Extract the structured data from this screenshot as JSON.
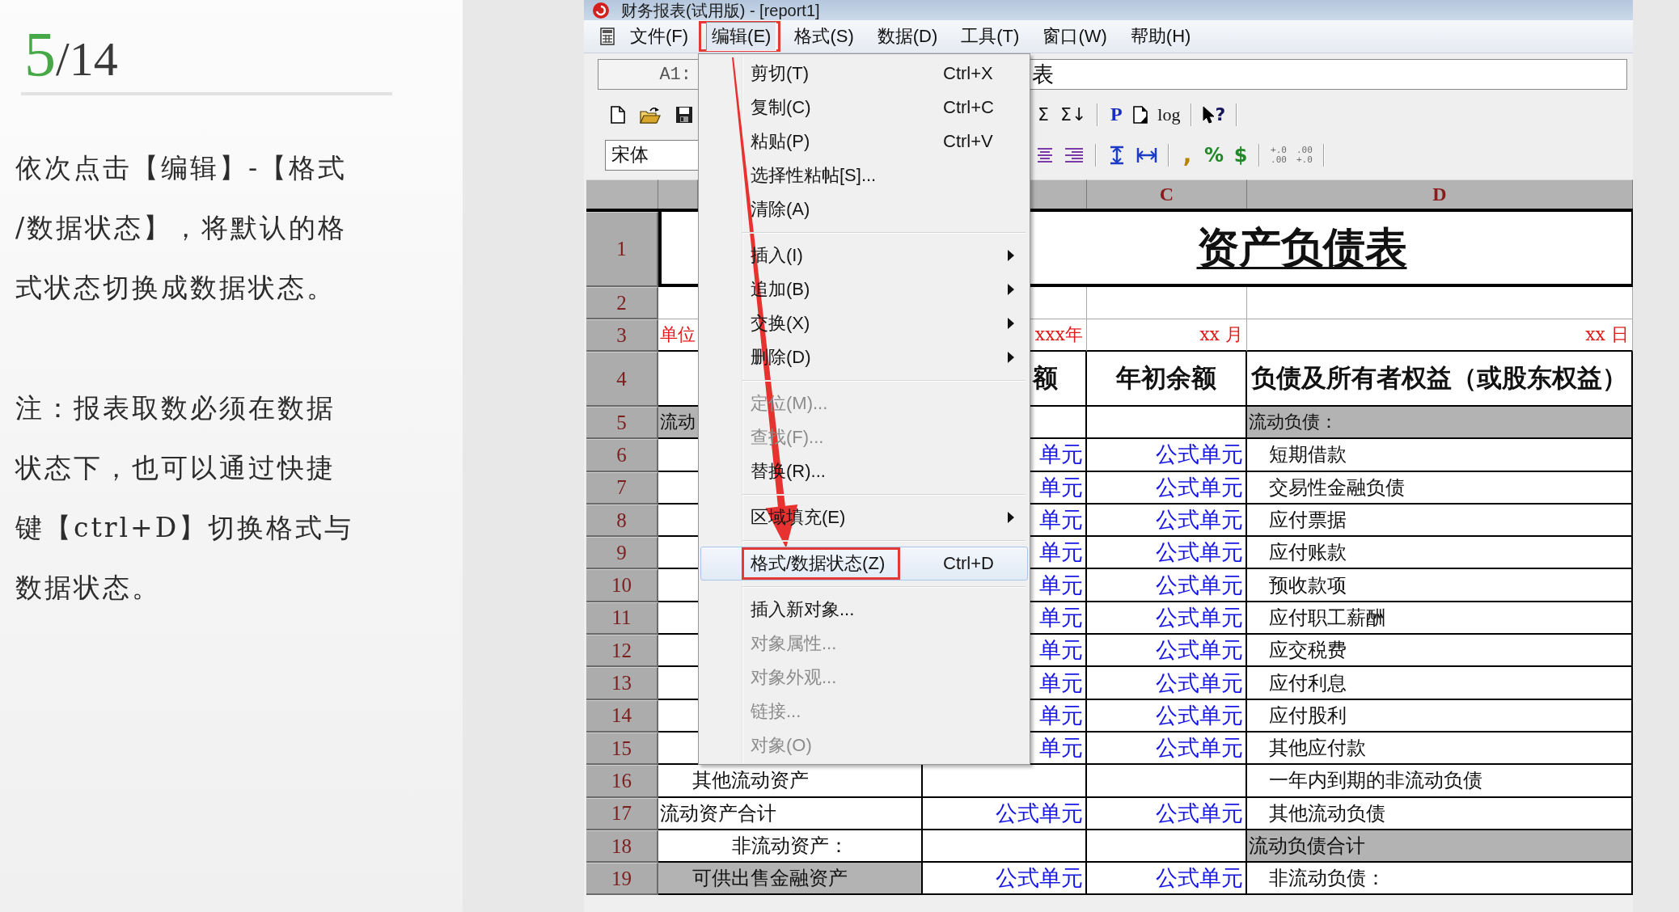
{
  "page_counter": {
    "current": "5",
    "total": "/14"
  },
  "instructions": [
    "依次点击【编辑】-【格式/数据状态】，将默认的格式状态切换成数据状态。",
    "注：报表取数必须在数据状态下，也可以通过快捷键【ctrl+D】切换格式与数据状态。"
  ],
  "window": {
    "title": "财务报表(试用版) - [report1]"
  },
  "menu_bar": [
    {
      "label": "文件(F)",
      "selected": false,
      "outlined": false
    },
    {
      "label": "编辑(E)",
      "selected": true,
      "outlined": true
    },
    {
      "label": "格式(S)",
      "selected": false,
      "outlined": false
    },
    {
      "label": "数据(D)",
      "selected": false,
      "outlined": false
    },
    {
      "label": "工具(T)",
      "selected": false,
      "outlined": false
    },
    {
      "label": "窗口(W)",
      "selected": false,
      "outlined": false
    },
    {
      "label": "帮助(H)",
      "selected": false,
      "outlined": false
    }
  ],
  "formula_bar": {
    "cell_ref": "A1:",
    "value": "表"
  },
  "toolbar_1": {
    "left": [
      {
        "kind": "new"
      },
      {
        "kind": "open"
      },
      {
        "kind": "save"
      }
    ],
    "right": [
      {
        "kind": "text",
        "glyph": "Σ"
      },
      {
        "kind": "text",
        "glyph": "Σ↓"
      },
      {
        "kind": "separator"
      },
      {
        "kind": "text-blue",
        "glyph": "P"
      },
      {
        "kind": "page"
      },
      {
        "kind": "text",
        "glyph": "log"
      },
      {
        "kind": "separator"
      },
      {
        "kind": "help",
        "glyph": "?"
      },
      {
        "kind": "separator"
      }
    ]
  },
  "toolbar_2": {
    "left": [
      {
        "kind": "font",
        "value": "宋体"
      }
    ],
    "right": [
      {
        "kind": "align-center"
      },
      {
        "kind": "align-right"
      },
      {
        "kind": "separator"
      },
      {
        "kind": "fit-height"
      },
      {
        "kind": "fit-width"
      },
      {
        "kind": "separator"
      },
      {
        "kind": "text-gold",
        "glyph": ","
      },
      {
        "kind": "text-green",
        "glyph": "%"
      },
      {
        "kind": "text-green",
        "glyph": "$"
      },
      {
        "kind": "separator"
      },
      {
        "kind": "decimals",
        "top": "+.0",
        "bottom": ".00"
      },
      {
        "kind": "decimals",
        "top": ".00",
        "bottom": "+.0"
      },
      {
        "kind": "separator"
      }
    ]
  },
  "edit_menu": {
    "arrow": true,
    "items": [
      {
        "kind": "item",
        "label": "剪切(T)",
        "shortcut": "Ctrl+X",
        "submenu": false,
        "disabled": false,
        "selected": false,
        "outlined": false
      },
      {
        "kind": "item",
        "label": "复制(C)",
        "shortcut": "Ctrl+C",
        "submenu": false,
        "disabled": false,
        "selected": false,
        "outlined": false
      },
      {
        "kind": "item",
        "label": "粘贴(P)",
        "shortcut": "Ctrl+V",
        "submenu": false,
        "disabled": false,
        "selected": false,
        "outlined": false
      },
      {
        "kind": "item",
        "label": "选择性粘帖[S]...",
        "submenu": false,
        "disabled": false,
        "selected": false,
        "outlined": false
      },
      {
        "kind": "item",
        "label": "清除(A)",
        "submenu": false,
        "disabled": false,
        "selected": false,
        "outlined": false
      },
      {
        "kind": "separator"
      },
      {
        "kind": "item",
        "label": "插入(I)",
        "submenu": true,
        "disabled": false,
        "selected": false,
        "outlined": false
      },
      {
        "kind": "item",
        "label": "追加(B)",
        "submenu": true,
        "disabled": false,
        "selected": false,
        "outlined": false
      },
      {
        "kind": "item",
        "label": "交换(X)",
        "submenu": true,
        "disabled": false,
        "selected": false,
        "outlined": false
      },
      {
        "kind": "item",
        "label": "删除(D)",
        "submenu": true,
        "disabled": false,
        "selected": false,
        "outlined": false
      },
      {
        "kind": "separator"
      },
      {
        "kind": "item",
        "label": "定位(M)...",
        "submenu": false,
        "disabled": true,
        "selected": false,
        "outlined": false
      },
      {
        "kind": "item",
        "label": "查找(F)...",
        "submenu": false,
        "disabled": true,
        "selected": false,
        "outlined": false
      },
      {
        "kind": "item",
        "label": "替换(R)...",
        "submenu": false,
        "disabled": false,
        "selected": false,
        "outlined": false
      },
      {
        "kind": "separator"
      },
      {
        "kind": "item",
        "label": "区域填充(E)",
        "submenu": true,
        "disabled": false,
        "selected": false,
        "outlined": false
      },
      {
        "kind": "separator"
      },
      {
        "kind": "item",
        "label": "格式/数据状态(Z)",
        "shortcut": "Ctrl+D",
        "submenu": false,
        "disabled": false,
        "selected": true,
        "outlined": true
      },
      {
        "kind": "separator"
      },
      {
        "kind": "item",
        "label": "插入新对象...",
        "submenu": false,
        "disabled": false,
        "selected": false,
        "outlined": false
      },
      {
        "kind": "item",
        "label": "对象属性...",
        "submenu": false,
        "disabled": true,
        "selected": false,
        "outlined": false
      },
      {
        "kind": "item",
        "label": "对象外观...",
        "submenu": false,
        "disabled": true,
        "selected": false,
        "outlined": false
      },
      {
        "kind": "item",
        "label": "链接...",
        "submenu": false,
        "disabled": true,
        "selected": false,
        "outlined": false
      },
      {
        "kind": "item",
        "label": "对象(O)",
        "submenu": false,
        "disabled": true,
        "selected": false,
        "outlined": false
      }
    ]
  },
  "sheet": {
    "column_headers": [
      "C",
      "D"
    ],
    "rows": [
      {
        "number": "1",
        "kind": "title",
        "title": "资产负债表"
      },
      {
        "number": "2",
        "kind": "blank"
      },
      {
        "number": "3",
        "kind": "unit",
        "col_a": {
          "text": "单位",
          "kind": "unit",
          "shaded": false
        },
        "col_b": {
          "text": "xxx年",
          "kind": "unit",
          "shaded": false
        },
        "col_c": {
          "text": "xx 月",
          "kind": "unit",
          "shaded": false
        },
        "col_d": {
          "text": "xx 日",
          "kind": "unit",
          "shaded": false
        }
      },
      {
        "number": "4",
        "kind": "header",
        "col_b": {
          "text": "额",
          "kind": "header",
          "shaded": false
        },
        "col_c": {
          "text": "年初余额",
          "kind": "header",
          "shaded": false
        },
        "col_d": {
          "text": "负债及所有者权益（或股东权益）",
          "kind": "header",
          "shaded": false
        }
      },
      {
        "number": "5",
        "kind": "data",
        "col_a": {
          "text": "流动",
          "kind": "section",
          "shaded": true
        },
        "col_d": {
          "text": "流动负债：",
          "kind": "section",
          "shaded": true
        }
      },
      {
        "number": "6",
        "kind": "data",
        "col_b": {
          "text": "单元",
          "kind": "formula",
          "shaded": false
        },
        "col_c": {
          "text": "公式单元",
          "kind": "formula",
          "shaded": false
        },
        "col_d": {
          "text": "短期借款",
          "kind": "item",
          "shaded": false
        }
      },
      {
        "number": "7",
        "kind": "data",
        "col_b": {
          "text": "单元",
          "kind": "formula",
          "shaded": false
        },
        "col_c": {
          "text": "公式单元",
          "kind": "formula",
          "shaded": false
        },
        "col_d": {
          "text": "交易性金融负债",
          "kind": "item",
          "shaded": false
        }
      },
      {
        "number": "8",
        "kind": "data",
        "col_b": {
          "text": "单元",
          "kind": "formula",
          "shaded": false
        },
        "col_c": {
          "text": "公式单元",
          "kind": "formula",
          "shaded": false
        },
        "col_d": {
          "text": "应付票据",
          "kind": "item",
          "shaded": false
        }
      },
      {
        "number": "9",
        "kind": "data",
        "col_b": {
          "text": "单元",
          "kind": "formula",
          "shaded": false
        },
        "col_c": {
          "text": "公式单元",
          "kind": "formula",
          "shaded": false
        },
        "col_d": {
          "text": "应付账款",
          "kind": "item",
          "shaded": false
        }
      },
      {
        "number": "10",
        "kind": "data",
        "col_b": {
          "text": "单元",
          "kind": "formula",
          "shaded": false
        },
        "col_c": {
          "text": "公式单元",
          "kind": "formula",
          "shaded": false
        },
        "col_d": {
          "text": "预收款项",
          "kind": "item",
          "shaded": false
        }
      },
      {
        "number": "11",
        "kind": "data",
        "col_b": {
          "text": "单元",
          "kind": "formula",
          "shaded": false
        },
        "col_c": {
          "text": "公式单元",
          "kind": "formula",
          "shaded": false
        },
        "col_d": {
          "text": "应付职工薪酬",
          "kind": "item",
          "shaded": false
        }
      },
      {
        "number": "12",
        "kind": "data",
        "col_b": {
          "text": "单元",
          "kind": "formula",
          "shaded": false
        },
        "col_c": {
          "text": "公式单元",
          "kind": "formula",
          "shaded": false
        },
        "col_d": {
          "text": "应交税费",
          "kind": "item",
          "shaded": false
        }
      },
      {
        "number": "13",
        "kind": "data",
        "col_b": {
          "text": "单元",
          "kind": "formula",
          "shaded": false
        },
        "col_c": {
          "text": "公式单元",
          "kind": "formula",
          "shaded": false
        },
        "col_d": {
          "text": "应付利息",
          "kind": "item",
          "shaded": false
        }
      },
      {
        "number": "14",
        "kind": "data",
        "col_b": {
          "text": "单元",
          "kind": "formula",
          "shaded": false
        },
        "col_c": {
          "text": "公式单元",
          "kind": "formula",
          "shaded": false
        },
        "col_d": {
          "text": "应付股利",
          "kind": "item",
          "shaded": false
        }
      },
      {
        "number": "15",
        "kind": "data",
        "col_b": {
          "text": "单元",
          "kind": "formula",
          "shaded": false
        },
        "col_c": {
          "text": "公式单元",
          "kind": "formula",
          "shaded": false
        },
        "col_d": {
          "text": "其他应付款",
          "kind": "item",
          "shaded": false
        }
      },
      {
        "number": "16",
        "kind": "data",
        "col_a": {
          "text": "其他流动资产",
          "kind": "item",
          "shaded": false
        },
        "col_d": {
          "text": "一年内到期的非流动负债",
          "kind": "item",
          "shaded": false
        }
      },
      {
        "number": "17",
        "kind": "data",
        "col_a": {
          "text": "流动资产合计",
          "kind": "total",
          "shaded": false
        },
        "col_b": {
          "text": "公式单元",
          "kind": "formula",
          "shaded": false
        },
        "col_c": {
          "text": "公式单元",
          "kind": "formula",
          "shaded": false
        },
        "col_d": {
          "text": "其他流动负债",
          "kind": "item",
          "shaded": false
        }
      },
      {
        "number": "18",
        "kind": "data",
        "col_a": {
          "text": "非流动资产：",
          "kind": "heading",
          "shaded": false
        },
        "col_d": {
          "text": "流动负债合计",
          "kind": "total",
          "shaded": true
        }
      },
      {
        "number": "19",
        "kind": "data",
        "col_a": {
          "text": "可供出售金融资产",
          "kind": "item",
          "shaded": true
        },
        "col_b": {
          "text": "公式单元",
          "kind": "formula",
          "shaded": false
        },
        "col_c": {
          "text": "公式单元",
          "kind": "formula",
          "shaded": false
        },
        "col_d": {
          "text": "非流动负债：",
          "kind": "item",
          "shaded": false
        }
      }
    ]
  }
}
